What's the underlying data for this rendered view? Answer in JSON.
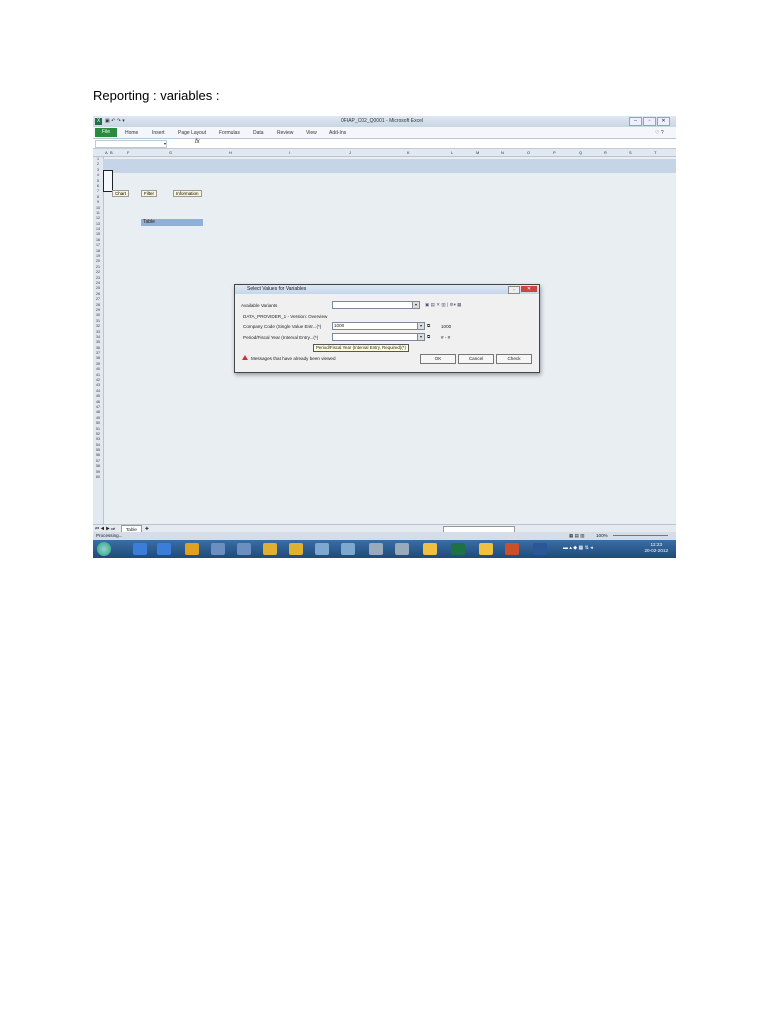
{
  "document": {
    "heading": "Reporting : variables :"
  },
  "excel": {
    "window_title": "0FIAP_C02_Q0001 - Microsoft Excel",
    "ribbon_tabs": [
      "File",
      "Home",
      "Insert",
      "Page Layout",
      "Formulas",
      "Data",
      "Review",
      "View",
      "Add-Ins"
    ],
    "columns": [
      "A",
      "B",
      "F",
      "G",
      "H",
      "I",
      "J",
      "K",
      "L",
      "M",
      "N",
      "O",
      "P",
      "Q",
      "R",
      "S",
      "T"
    ],
    "rows": [
      "1",
      "2",
      "3",
      "4",
      "5",
      "6",
      "7",
      "8",
      "9",
      "10",
      "11",
      "12",
      "13",
      "14",
      "15",
      "16",
      "17",
      "18",
      "19",
      "20",
      "21",
      "22",
      "23",
      "24",
      "25",
      "26",
      "27",
      "28",
      "29",
      "30",
      "31",
      "32",
      "33",
      "34",
      "35",
      "36",
      "37",
      "38",
      "39",
      "40",
      "41",
      "42",
      "43",
      "44",
      "45",
      "46",
      "47",
      "48",
      "49",
      "50",
      "51",
      "52",
      "53",
      "54",
      "55",
      "56",
      "57",
      "58",
      "59",
      "60"
    ],
    "buttons": {
      "chart": "Chart",
      "filter": "Filter",
      "information": "Information"
    },
    "table_cell": "Table",
    "sheet_tab": "Table",
    "status": "Processing...",
    "zoom": "100%"
  },
  "dialog": {
    "title": "Select Values for Variables",
    "available_variants_label": "Available Variants",
    "available_variants_value": "",
    "provider": "DATA_PROVIDER_1 - Version: Overview",
    "company_code_label": "Company Code (Single Value Entr...(*)",
    "company_code_value": "1000",
    "company_code_display": "1000",
    "period_label": "Period/Fiscal Year (Interval Entry...(*)",
    "period_value": "",
    "period_display": "# - #",
    "tooltip": "Period/Fiscal Year (Interval Entry, Required)(*)",
    "warning": "Messages that have already been viewed",
    "ok": "OK",
    "cancel": "Cancel",
    "check": "Check"
  },
  "taskbar": {
    "time": "12:23",
    "date": "20-02-2012"
  }
}
